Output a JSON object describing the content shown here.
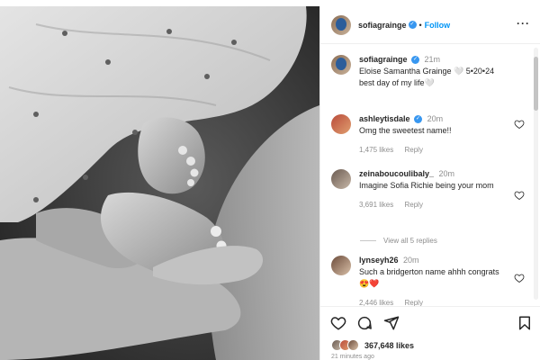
{
  "post": {
    "author": "sofiagrainge",
    "follow_label": "Follow",
    "separator": "•",
    "more_icon": "more-horizontal-icon"
  },
  "caption": {
    "username": "sofiagrainge",
    "time": "21m",
    "line1": "Eloise Samantha Grainge 🤍 5•20•24",
    "line2": "best day of my life🤍"
  },
  "comments": [
    {
      "username": "ashleytisdale",
      "verified": true,
      "time": "20m",
      "text": "Omg the sweetest name!!",
      "likes": "1,475 likes",
      "reply": "Reply"
    },
    {
      "username": "zeinaboucoulibaly_",
      "verified": false,
      "time": "20m",
      "text": "Imagine Sofia Richie being your mom",
      "likes": "3,691 likes",
      "reply": "Reply",
      "view_replies": "View all 5 replies"
    },
    {
      "username": "lynseyh26",
      "verified": false,
      "time": "20m",
      "text": "Such a bridgerton name ahhh congrats 😍❤️",
      "likes": "2,446 likes",
      "reply": "Reply"
    }
  ],
  "actions": {
    "like_icon": "heart-icon",
    "comment_icon": "comment-icon",
    "share_icon": "share-icon",
    "save_icon": "bookmark-icon"
  },
  "likes_total": "367,648 likes",
  "posted_ago": "21 minutes ago",
  "colors": {
    "link_blue": "#0095f6",
    "verified_blue": "#3897f0",
    "muted": "#8e8e8e",
    "text": "#262626"
  }
}
